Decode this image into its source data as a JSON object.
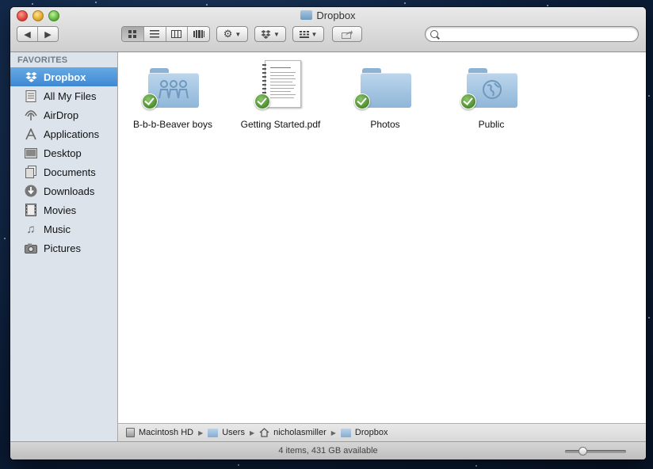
{
  "window": {
    "title": "Dropbox"
  },
  "toolbar": {
    "back_glyph": "◀",
    "forward_glyph": "▶",
    "view_modes": [
      "icon-view",
      "list-view",
      "column-view",
      "coverflow-view"
    ],
    "action_menu": "gear-icon",
    "dropbox_menu": "dropbox-icon",
    "arrange_menu": "arrange-icon",
    "share_button": "share-icon",
    "search": {
      "placeholder": "",
      "value": ""
    }
  },
  "sidebar": {
    "heading": "FAVORITES",
    "items": [
      {
        "label": "Dropbox",
        "icon": "dropbox-icon",
        "selected": true
      },
      {
        "label": "All My Files",
        "icon": "all-files-icon"
      },
      {
        "label": "AirDrop",
        "icon": "airdrop-icon"
      },
      {
        "label": "Applications",
        "icon": "applications-icon"
      },
      {
        "label": "Desktop",
        "icon": "desktop-icon"
      },
      {
        "label": "Documents",
        "icon": "documents-icon"
      },
      {
        "label": "Downloads",
        "icon": "downloads-icon"
      },
      {
        "label": "Movies",
        "icon": "movies-icon"
      },
      {
        "label": "Music",
        "icon": "music-icon"
      },
      {
        "label": "Pictures",
        "icon": "pictures-icon"
      }
    ]
  },
  "files": [
    {
      "name": "B-b-b-Beaver boys",
      "kind": "shared-folder",
      "synced": true
    },
    {
      "name": "Getting Started.pdf",
      "kind": "pdf-document",
      "synced": true
    },
    {
      "name": "Photos",
      "kind": "folder",
      "synced": true
    },
    {
      "name": "Public",
      "kind": "public-folder",
      "synced": true
    }
  ],
  "path": [
    {
      "label": "Macintosh HD",
      "icon": "hard-drive-icon"
    },
    {
      "label": "Users",
      "icon": "folder-icon"
    },
    {
      "label": "nicholasmiller",
      "icon": "home-icon"
    },
    {
      "label": "Dropbox",
      "icon": "folder-icon"
    }
  ],
  "status": {
    "text": "4 items, 431 GB available",
    "icon_size_level": 0.25
  },
  "colors": {
    "selection": "#3f88d2",
    "sidebar_bg": "#dde3ea",
    "sync_check": "#4c8c2f"
  }
}
